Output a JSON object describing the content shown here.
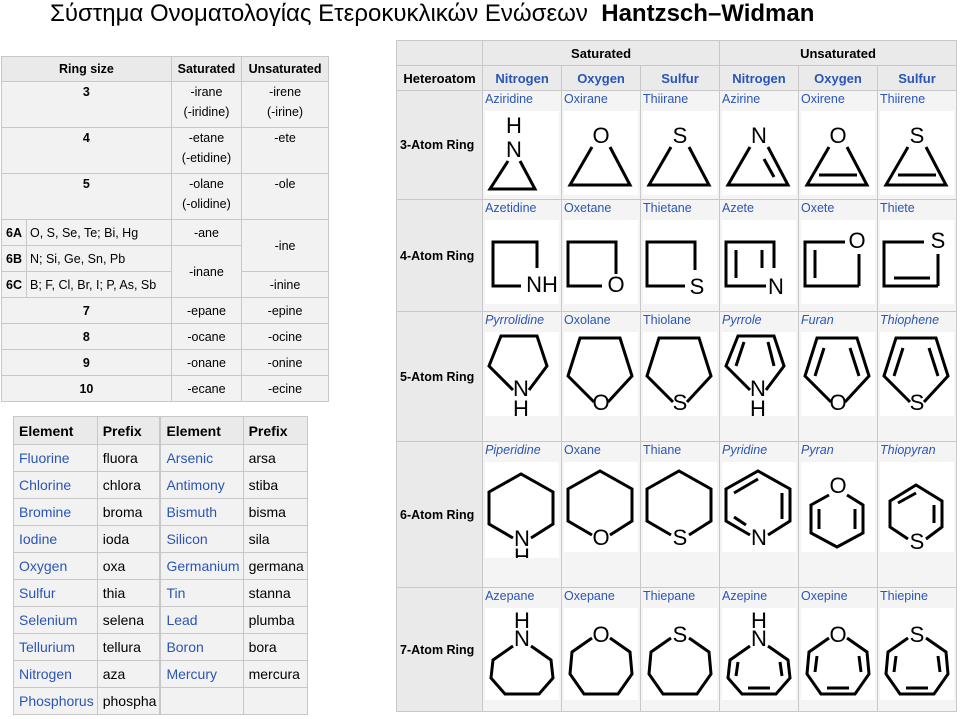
{
  "title": {
    "greek": "Σύστημα Ονοματολογίας Ετεροκυκλικών Ενώσεων",
    "name": "Hantzsch–Widman"
  },
  "ring_table": {
    "headers": [
      "Ring size",
      "Saturated",
      "Unsaturated"
    ],
    "rows": [
      {
        "size": "3",
        "sat1": "-irane",
        "sat2": "(-iridine)",
        "unsat1": "-irene",
        "unsat2": "(-irine)"
      },
      {
        "size": "4",
        "sat1": "-etane",
        "sat2": "(-etidine)",
        "unsat1": "-ete",
        "unsat2": ""
      },
      {
        "size": "5",
        "sat1": "-olane",
        "sat2": "(-olidine)",
        "unsat1": "-ole",
        "unsat2": ""
      }
    ],
    "group6": {
      "a_label": "6A",
      "a_elements": "O, S, Se, Te; Bi, Hg",
      "a_sat": "-ane",
      "b_label": "6B",
      "b_elements": "N; Si, Ge, Sn, Pb",
      "bc_sat": "-inane",
      "ab_unsat": "-ine",
      "c_label": "6C",
      "c_elements": "B; F, Cl, Br, I; P, As, Sb",
      "c_unsat": "-inine"
    },
    "rows2": [
      {
        "size": "7",
        "sat": "-epane",
        "unsat": "-epine"
      },
      {
        "size": "8",
        "sat": "-ocane",
        "unsat": "-ocine"
      },
      {
        "size": "9",
        "sat": "-onane",
        "unsat": "-onine"
      },
      {
        "size": "10",
        "sat": "-ecane",
        "unsat": "-ecine"
      }
    ]
  },
  "prefix_table": {
    "headers": [
      "Element",
      "Prefix",
      "Element",
      "Prefix"
    ],
    "rows": [
      [
        "Fluorine",
        "fluora",
        "Arsenic",
        "arsa"
      ],
      [
        "Chlorine",
        "chlora",
        "Antimony",
        "stiba"
      ],
      [
        "Bromine",
        "broma",
        "Bismuth",
        "bisma"
      ],
      [
        "Iodine",
        "ioda",
        "Silicon",
        "sila"
      ],
      [
        "Oxygen",
        "oxa",
        "Germanium",
        "germana"
      ],
      [
        "Sulfur",
        "thia",
        "Tin",
        "stanna"
      ],
      [
        "Selenium",
        "selena",
        "Lead",
        "plumba"
      ],
      [
        "Tellurium",
        "tellura",
        "Boron",
        "bora"
      ],
      [
        "Nitrogen",
        "aza",
        "Mercury",
        "mercura"
      ],
      [
        "Phosphorus",
        "phospha",
        "",
        ""
      ]
    ]
  },
  "grid": {
    "group_headers": [
      "Saturated",
      "Unsaturated"
    ],
    "heteroatom_label": "Heteroatom",
    "heteroatoms": [
      "Nitrogen",
      "Oxygen",
      "Sulfur",
      "Nitrogen",
      "Oxygen",
      "Sulfur"
    ],
    "rows": [
      {
        "label": "3-Atom Ring",
        "names": [
          "Aziridine",
          "Oxirane",
          "Thiirane",
          "Azirine",
          "Oxirene",
          "Thiirene"
        ]
      },
      {
        "label": "4-Atom Ring",
        "names": [
          "Azetidine",
          "Oxetane",
          "Thietane",
          "Azete",
          "Oxete",
          "Thiete"
        ]
      },
      {
        "label": "5-Atom Ring",
        "names": [
          "Pyrrolidine",
          "Oxolane",
          "Thiolane",
          "Pyrrole",
          "Furan",
          "Thiophene"
        ]
      },
      {
        "label": "6-Atom Ring",
        "names": [
          "Piperidine",
          "Oxane",
          "Thiane",
          "Pyridine",
          "Pyran",
          "Thiopyran"
        ]
      },
      {
        "label": "7-Atom Ring",
        "names": [
          "Azepane",
          "Oxepane",
          "Thiepane",
          "Azepine",
          "Oxepine",
          "Thiepine"
        ]
      }
    ],
    "atom_symbols": {
      "N": "N",
      "O": "O",
      "S": "S",
      "H": "H",
      "NH": "NH"
    }
  }
}
